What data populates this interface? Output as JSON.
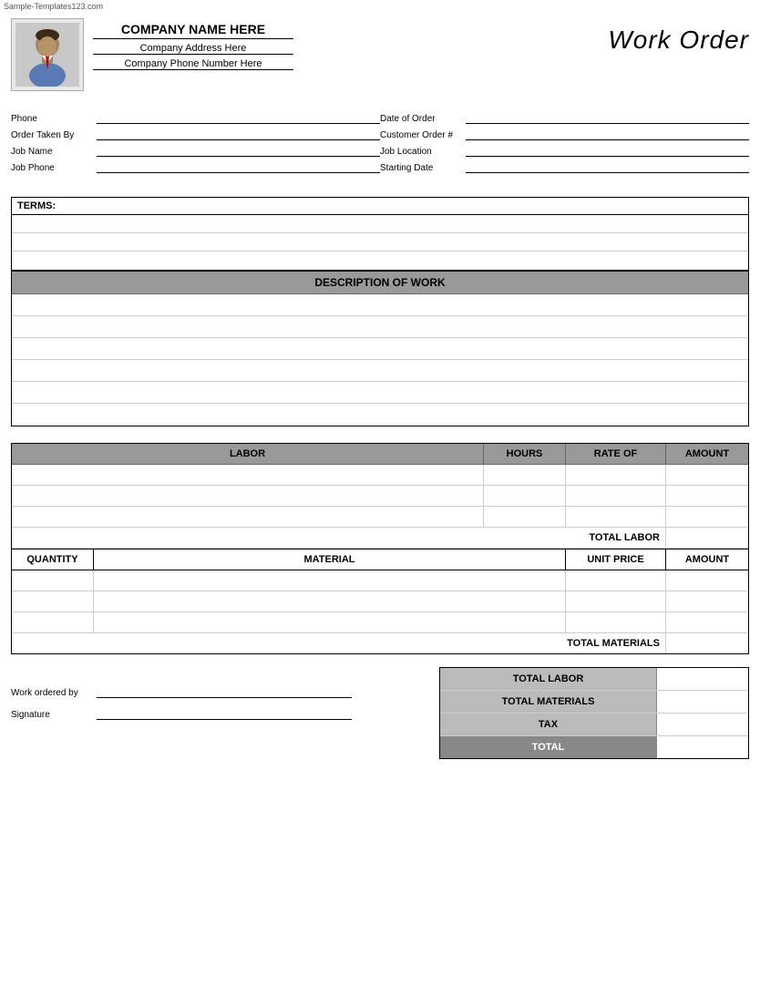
{
  "watermark": "Sample-Templates123.com",
  "header": {
    "company_name": "COMPANY NAME HERE",
    "company_address": "Company Address Here",
    "company_phone": "Company Phone Number Here",
    "title": "Work Order"
  },
  "form": {
    "left": [
      {
        "label": "Phone",
        "value": ""
      },
      {
        "label": "Order Taken By",
        "value": ""
      },
      {
        "label": "Job Name",
        "value": ""
      },
      {
        "label": "Job Phone",
        "value": ""
      }
    ],
    "right": [
      {
        "label": "Date of Order",
        "value": ""
      },
      {
        "label": "Customer Order #",
        "value": ""
      },
      {
        "label": "Job Location",
        "value": ""
      },
      {
        "label": "Starting Date",
        "value": ""
      }
    ]
  },
  "terms": {
    "label": "TERMS:",
    "rows": [
      "",
      "",
      ""
    ]
  },
  "description": {
    "header": "DESCRIPTION OF WORK",
    "rows": [
      "",
      "",
      "",
      "",
      "",
      ""
    ]
  },
  "labor": {
    "columns": [
      "LABOR",
      "HOURS",
      "RATE OF",
      "AMOUNT"
    ],
    "rows": [
      [
        "",
        "",
        "",
        ""
      ],
      [
        "",
        "",
        "",
        ""
      ],
      [
        "",
        "",
        "",
        ""
      ]
    ],
    "total_label": "TOTAL LABOR",
    "total_value": ""
  },
  "materials": {
    "columns": [
      "QUANTITY",
      "MATERIAL",
      "UNIT PRICE",
      "AMOUNT"
    ],
    "rows": [
      [
        "",
        "",
        "",
        ""
      ],
      [
        "",
        "",
        "",
        ""
      ],
      [
        "",
        "",
        "",
        ""
      ]
    ],
    "total_label": "TOTAL MATERIALS",
    "total_value": ""
  },
  "summary": {
    "rows": [
      {
        "label": "TOTAL LABOR",
        "value": ""
      },
      {
        "label": "TOTAL MATERIALS",
        "value": ""
      },
      {
        "label": "TAX",
        "value": ""
      },
      {
        "label": "TOTAL",
        "value": ""
      }
    ],
    "work_ordered_by_label": "Work ordered by",
    "signature_label": "Signature"
  }
}
